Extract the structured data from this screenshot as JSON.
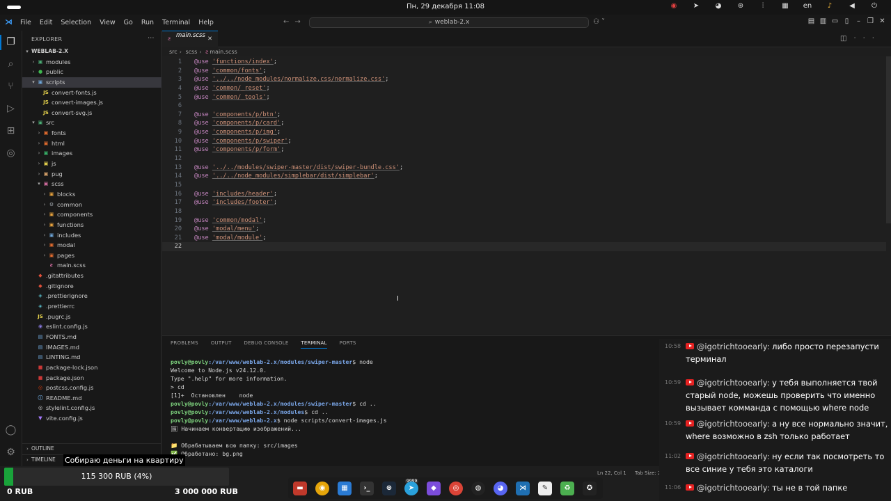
{
  "system_bar": {
    "clock": "Пн, 29 декабря  11:08",
    "language": "en",
    "tray_icons": [
      "obs-icon",
      "telegram-icon",
      "discord-icon",
      "steam-icon",
      "equalizer-icon",
      "teams-icon",
      "language",
      "mic-icon",
      "sound-icon",
      "power-icon"
    ]
  },
  "titlebar": {
    "menus": [
      "File",
      "Edit",
      "Selection",
      "View",
      "Go",
      "Run",
      "Terminal",
      "Help"
    ],
    "search": "weblab-2.x"
  },
  "sidebar": {
    "title": "EXPLORER",
    "root": "WEBLAB-2.X",
    "items": [
      {
        "label": "modules",
        "kind": "folder",
        "depth": 1,
        "open": false,
        "icon": "▣",
        "color": "#4caf76"
      },
      {
        "label": "public",
        "kind": "folder",
        "depth": 1,
        "open": false,
        "icon": "●",
        "color": "#3fb950"
      },
      {
        "label": "scripts",
        "kind": "folder",
        "depth": 1,
        "open": true,
        "icon": "▣",
        "color": "#6fa8dc"
      },
      {
        "label": "convert-fonts.js",
        "kind": "file",
        "depth": 2,
        "icon": "JS",
        "color": "#e8d44d"
      },
      {
        "label": "convert-images.js",
        "kind": "file",
        "depth": 2,
        "icon": "JS",
        "color": "#e8d44d"
      },
      {
        "label": "convert-svg.js",
        "kind": "file",
        "depth": 2,
        "icon": "JS",
        "color": "#e8d44d"
      },
      {
        "label": "src",
        "kind": "folder",
        "depth": 1,
        "open": true,
        "icon": "▣",
        "color": "#4caf76"
      },
      {
        "label": "fonts",
        "kind": "folder",
        "depth": 2,
        "open": false,
        "icon": "▣",
        "color": "#e46d2f"
      },
      {
        "label": "html",
        "kind": "folder",
        "depth": 2,
        "open": false,
        "icon": "▣",
        "color": "#e46d2f"
      },
      {
        "label": "images",
        "kind": "folder",
        "depth": 2,
        "open": false,
        "icon": "▣",
        "color": "#38b46a"
      },
      {
        "label": "js",
        "kind": "folder",
        "depth": 2,
        "open": false,
        "icon": "▣",
        "color": "#e8d44d"
      },
      {
        "label": "pug",
        "kind": "folder",
        "depth": 2,
        "open": false,
        "icon": "▣",
        "color": "#d9a36b"
      },
      {
        "label": "scss",
        "kind": "folder",
        "depth": 2,
        "open": true,
        "icon": "▣",
        "color": "#d06c9e"
      },
      {
        "label": "blocks",
        "kind": "folder",
        "depth": 3,
        "open": false,
        "icon": "▣",
        "color": "#e8a33d"
      },
      {
        "label": "common",
        "kind": "folder",
        "depth": 3,
        "open": false,
        "icon": "⚙",
        "color": "#9aa0a6"
      },
      {
        "label": "components",
        "kind": "folder",
        "depth": 3,
        "open": false,
        "icon": "▣",
        "color": "#e8a33d"
      },
      {
        "label": "functions",
        "kind": "folder",
        "depth": 3,
        "open": false,
        "icon": "▣",
        "color": "#e8a33d"
      },
      {
        "label": "includes",
        "kind": "folder",
        "depth": 3,
        "open": false,
        "icon": "▣",
        "color": "#6fa8dc"
      },
      {
        "label": "modal",
        "kind": "folder",
        "depth": 3,
        "open": false,
        "icon": "▣",
        "color": "#e46d2f"
      },
      {
        "label": "pages",
        "kind": "folder",
        "depth": 3,
        "open": false,
        "icon": "▣",
        "color": "#e46d2f"
      },
      {
        "label": "main.scss",
        "kind": "file",
        "depth": 3,
        "icon": "ƨ",
        "color": "#d06c9e"
      },
      {
        "label": ".gitattributes",
        "kind": "file",
        "depth": 1,
        "icon": "◆",
        "color": "#e0503a"
      },
      {
        "label": ".gitignore",
        "kind": "file",
        "depth": 1,
        "icon": "◆",
        "color": "#e0503a"
      },
      {
        "label": ".prettierignore",
        "kind": "file",
        "depth": 1,
        "icon": "◈",
        "color": "#56b6c2"
      },
      {
        "label": ".prettierrc",
        "kind": "file",
        "depth": 1,
        "icon": "◈",
        "color": "#56b6c2"
      },
      {
        "label": ".pugrc.js",
        "kind": "file",
        "depth": 1,
        "icon": "JS",
        "color": "#e8d44d"
      },
      {
        "label": "eslint.config.js",
        "kind": "file",
        "depth": 1,
        "icon": "◉",
        "color": "#8a7ae0"
      },
      {
        "label": "FONTS.md",
        "kind": "file",
        "depth": 1,
        "icon": "▤",
        "color": "#6fa8dc"
      },
      {
        "label": "IMAGES.md",
        "kind": "file",
        "depth": 1,
        "icon": "▤",
        "color": "#6fa8dc"
      },
      {
        "label": "LINTING.md",
        "kind": "file",
        "depth": 1,
        "icon": "▤",
        "color": "#6fa8dc"
      },
      {
        "label": "package-lock.json",
        "kind": "file",
        "depth": 1,
        "icon": "■",
        "color": "#cb3837"
      },
      {
        "label": "package.json",
        "kind": "file",
        "depth": 1,
        "icon": "■",
        "color": "#cb3837"
      },
      {
        "label": "postcss.config.js",
        "kind": "file",
        "depth": 1,
        "icon": "◎",
        "color": "#dd3a0a"
      },
      {
        "label": "README.md",
        "kind": "file",
        "depth": 1,
        "icon": "ⓘ",
        "color": "#6fa8dc"
      },
      {
        "label": "stylelint.config.js",
        "kind": "file",
        "depth": 1,
        "icon": "◎",
        "color": "#dcdcdc"
      },
      {
        "label": "vite.config.js",
        "kind": "file",
        "depth": 1,
        "icon": "▼",
        "color": "#a67aff"
      }
    ],
    "outline": "OUTLINE",
    "timeline": "TIMELINE"
  },
  "editor": {
    "tab": "main.scss",
    "breadcrumb": [
      "src",
      "scss",
      "main.scss"
    ],
    "lines": [
      {
        "n": "1",
        "kw": "@use",
        "str": "'functions/index'",
        "end": ";"
      },
      {
        "n": "2",
        "kw": "@use",
        "str": "'common/fonts'",
        "end": ";"
      },
      {
        "n": "3",
        "kw": "@use",
        "str": "'../../node_modules/normalize.css/normalize.css'",
        "end": ";"
      },
      {
        "n": "4",
        "kw": "@use",
        "str": "'common/_reset'",
        "end": ";"
      },
      {
        "n": "5",
        "kw": "@use",
        "str": "'common/_tools'",
        "end": ";"
      },
      {
        "n": "6",
        "kw": "",
        "str": "",
        "end": ""
      },
      {
        "n": "7",
        "kw": "@use",
        "str": "'components/p/btn'",
        "end": ";"
      },
      {
        "n": "8",
        "kw": "@use",
        "str": "'components/p/card'",
        "end": ";"
      },
      {
        "n": "9",
        "kw": "@use",
        "str": "'components/p/img'",
        "end": ";"
      },
      {
        "n": "10",
        "kw": "@use",
        "str": "'components/p/swiper'",
        "end": ";"
      },
      {
        "n": "11",
        "kw": "@use",
        "str": "'components/p/form'",
        "end": ";"
      },
      {
        "n": "12",
        "kw": "",
        "str": "",
        "end": ""
      },
      {
        "n": "13",
        "kw": "@use",
        "str": "'../../modules/swiper-master/dist/swiper-bundle.css'",
        "end": ";"
      },
      {
        "n": "14",
        "kw": "@use",
        "str": "'../../node_modules/simplebar/dist/simplebar'",
        "end": ";"
      },
      {
        "n": "15",
        "kw": "",
        "str": "",
        "end": ""
      },
      {
        "n": "16",
        "kw": "@use",
        "str": "'includes/header'",
        "end": ";"
      },
      {
        "n": "17",
        "kw": "@use",
        "str": "'includes/footer'",
        "end": ";"
      },
      {
        "n": "18",
        "kw": "",
        "str": "",
        "end": ""
      },
      {
        "n": "19",
        "kw": "@use",
        "str": "'common/modal'",
        "end": ";"
      },
      {
        "n": "20",
        "kw": "@use",
        "str": "'modal/menu'",
        "end": ";"
      },
      {
        "n": "21",
        "kw": "@use",
        "str": "'modal/module'",
        "end": ";"
      },
      {
        "n": "22",
        "kw": "",
        "str": "",
        "end": ""
      }
    ],
    "status_position": "Ln 22, Col 1",
    "status_tab": "Tab Size: 2"
  },
  "panel": {
    "tabs": [
      "PROBLEMS",
      "OUTPUT",
      "DEBUG CONSOLE",
      "TERMINAL",
      "PORTS"
    ],
    "active_tab": "TERMINAL",
    "terminal": [
      {
        "prompt": "povly@povly",
        "path": ":/var/www/weblab-2.x/modules/swiper-master",
        "cmd": "$ node"
      },
      {
        "prompt": "",
        "path": "",
        "cmd": "Welcome to Node.js v24.12.0."
      },
      {
        "prompt": "",
        "path": "",
        "cmd": "Type \".help\" for more information."
      },
      {
        "prompt": "",
        "path": "",
        "cmd": "> cd"
      },
      {
        "prompt": "",
        "path": "",
        "cmd": "[1]+  Остановлен    node"
      },
      {
        "prompt": "povly@povly",
        "path": ":/var/www/weblab-2.x/modules/swiper-master",
        "cmd": "$ cd .."
      },
      {
        "prompt": "povly@povly",
        "path": ":/var/www/weblab-2.x/modules",
        "cmd": "$ cd .."
      },
      {
        "prompt": "povly@povly",
        "path": ":/var/www/weblab-2.x",
        "cmd": "$ node scripts/convert-images.js"
      },
      {
        "prompt": "",
        "path": "",
        "cmd": "🖼 Начинаем конвертацию изображений..."
      },
      {
        "prompt": "",
        "path": "",
        "cmd": ""
      },
      {
        "prompt": "",
        "path": "",
        "cmd": "📁 Обрабатываем всю папку: src/images"
      },
      {
        "prompt": "",
        "path": "",
        "cmd": "✅ Обработано: bg.png"
      }
    ]
  },
  "chat": {
    "messages": [
      {
        "time": "10:58",
        "user": "@igotrichtooearly:",
        "text": "либо просто перезапусти терминал"
      },
      {
        "time": "10:59",
        "user": "@igotrichtooearly:",
        "text": "у тебя выполняется твой старый node, можешь проверить что именно вызывает комманда с помощью where node"
      },
      {
        "time": "10:59",
        "user": "@igotrichtooearly:",
        "text": "а ну все нормально значит, where возможно в zsh только работает"
      },
      {
        "time": "11:02",
        "user": "@igotrichtooearly:",
        "text": "ну если так посмотреть то все синие у тебя это каталоги"
      },
      {
        "time": "11:06",
        "user": "@igotrichtooearly:",
        "text": "ты не в той папке"
      }
    ]
  },
  "donation": {
    "title": "Собираю деньги на квартиру",
    "amount": "115 300 RUB (4%)",
    "progress": 0.04,
    "min": "0 RUB",
    "max": "3 000 000 RUB",
    "fill_color": "#19a33a"
  },
  "dock": {
    "badge": "9999",
    "icons": [
      "files-icon",
      "rhythmbox-icon",
      "store-icon",
      "terminal-icon",
      "steam-icon",
      "telegram-icon",
      "obsidian-icon",
      "chrome-icon",
      "obs-icon",
      "discord-icon",
      "vscode-icon",
      "notes-icon",
      "trash-icon",
      "settings-icon"
    ]
  }
}
